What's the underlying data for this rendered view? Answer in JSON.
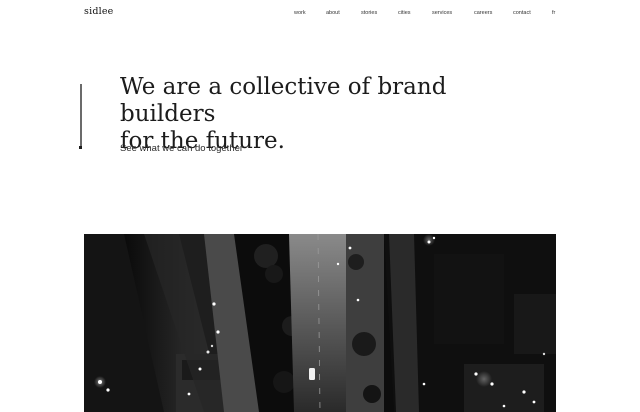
{
  "header": {
    "logo": "sidlee",
    "nav": [
      {
        "label": "work"
      },
      {
        "label": "about"
      },
      {
        "label": "stories"
      },
      {
        "label": "cities"
      },
      {
        "label": "services"
      },
      {
        "label": "careers"
      },
      {
        "label": "contact"
      },
      {
        "label": "fr"
      }
    ]
  },
  "hero": {
    "headline_line1": "We are a collective of brand builders",
    "headline_line2": "for the future.",
    "subline": "See what we can do together"
  },
  "media": {
    "icon": "aerial-city-street-photo"
  }
}
